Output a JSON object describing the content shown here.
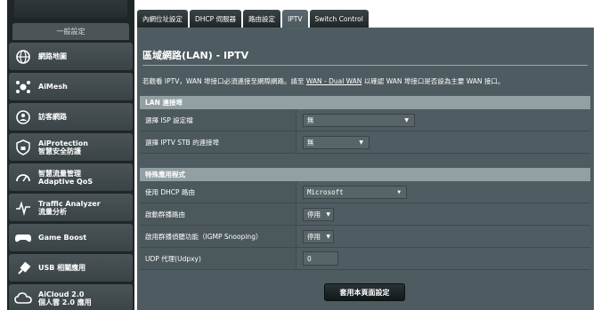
{
  "sidebar": {
    "header": "一般設定",
    "items": [
      {
        "icon": "globe-network-icon",
        "label": "網路地圖"
      },
      {
        "icon": "aimesh-icon",
        "label": "AiMesh"
      },
      {
        "icon": "guest-network-icon",
        "label": "訪客網路"
      },
      {
        "icon": "shield-lock-icon",
        "label": "AiProtection\n智慧安全防護"
      },
      {
        "icon": "gauge-icon",
        "label": "智慧流量管理\nAdaptive QoS"
      },
      {
        "icon": "traffic-analyzer-icon",
        "label": "Traffic Analyzer\n流量分析"
      },
      {
        "icon": "gamepad-icon",
        "label": "Game Boost"
      },
      {
        "icon": "usb-icon",
        "label": "USB 相關應用"
      },
      {
        "icon": "cloud-icon",
        "label": "AiCloud 2.0\n個人雲 2.0 應用"
      }
    ]
  },
  "tabs": [
    "內網位址設定",
    "DHCP 伺服器",
    "路由設定",
    "IPTV",
    "Switch Control"
  ],
  "active_tab": "IPTV",
  "page": {
    "title": "區域網路(LAN) - IPTV",
    "description_pre": "若觀看 IPTV，WAN 埠接口必須連接至網際網路。請至 ",
    "description_link": "WAN - Dual WAN",
    "description_post": " 以確認 WAN 埠接口是否設為主要 WAN 接口。"
  },
  "lan_section": {
    "header": "LAN 連接埠",
    "rows": [
      {
        "label": "選擇 ISP 設定檔",
        "value": "無"
      },
      {
        "label": "選擇 IPTV STB 的連接埠",
        "value": "無"
      }
    ]
  },
  "special_section": {
    "header": "特殊應用程式",
    "rows": [
      {
        "label": "使用 DHCP 路由",
        "value": "Microsoft"
      },
      {
        "label": "啟動群播路由",
        "value": "停用"
      },
      {
        "label": "啟用群播偵聽功能（IGMP Snooping）",
        "value": "停用"
      },
      {
        "label": "UDP 代理(Udpxy)",
        "value": "0"
      }
    ]
  },
  "apply_label": "套用本頁面設定"
}
